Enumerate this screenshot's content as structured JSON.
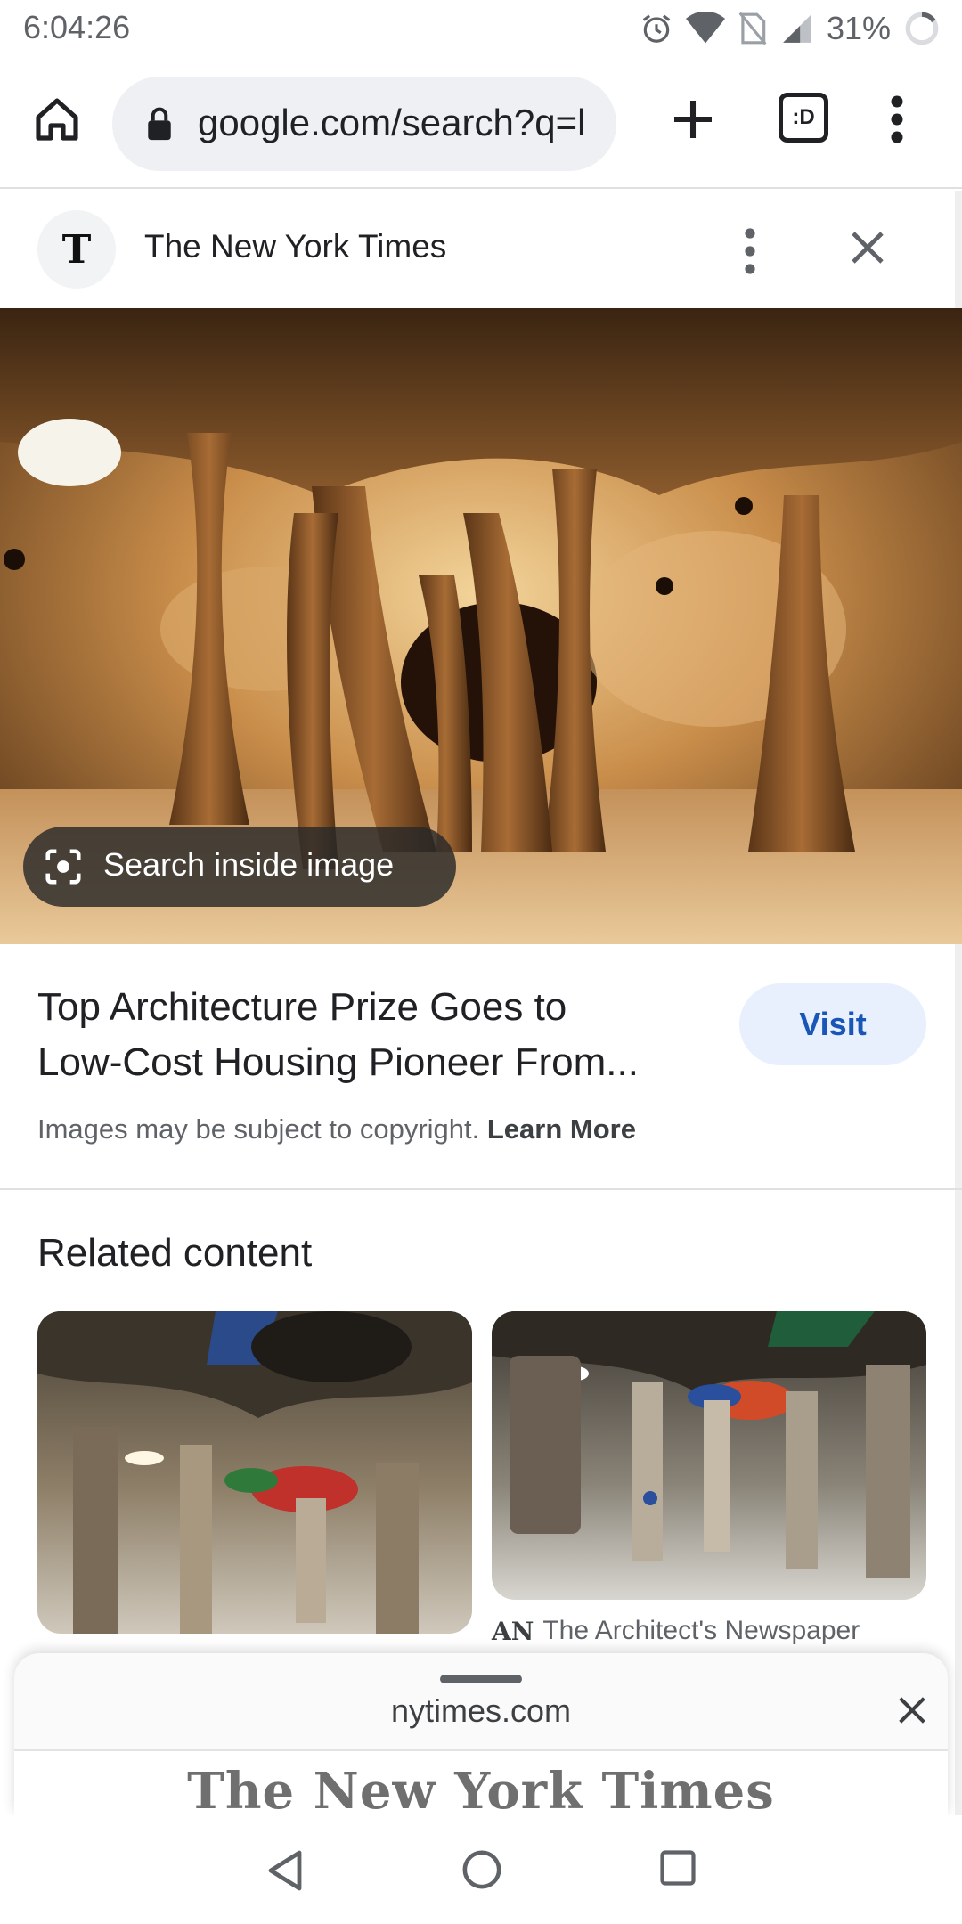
{
  "status_bar": {
    "time": "6:04:26",
    "battery": "31%"
  },
  "browser": {
    "url": "google.com/search?q=l",
    "tabs_count_icon": ":D"
  },
  "source": {
    "name": "The New York Times",
    "logo_letter": "T"
  },
  "image": {
    "search_inside_label": "Search inside image"
  },
  "result": {
    "title_line1": "Top Architecture Prize Goes to",
    "title_line2": "Low-Cost Housing Pioneer From...",
    "visit_label": "Visit",
    "copyright_text": "Images may be subject to copyright.",
    "learn_more": "Learn More"
  },
  "related": {
    "title": "Related content",
    "cards": [
      {
        "source": ""
      },
      {
        "source": "The Architect's Newspaper",
        "source_logo": "AN"
      }
    ]
  },
  "bottom_sheet": {
    "domain": "nytimes.com",
    "masthead": "The New York Times"
  },
  "colors": {
    "accent": "#1a56b8",
    "visit_bg": "#e8f0fe",
    "omnibox_bg": "#eef0f3"
  }
}
